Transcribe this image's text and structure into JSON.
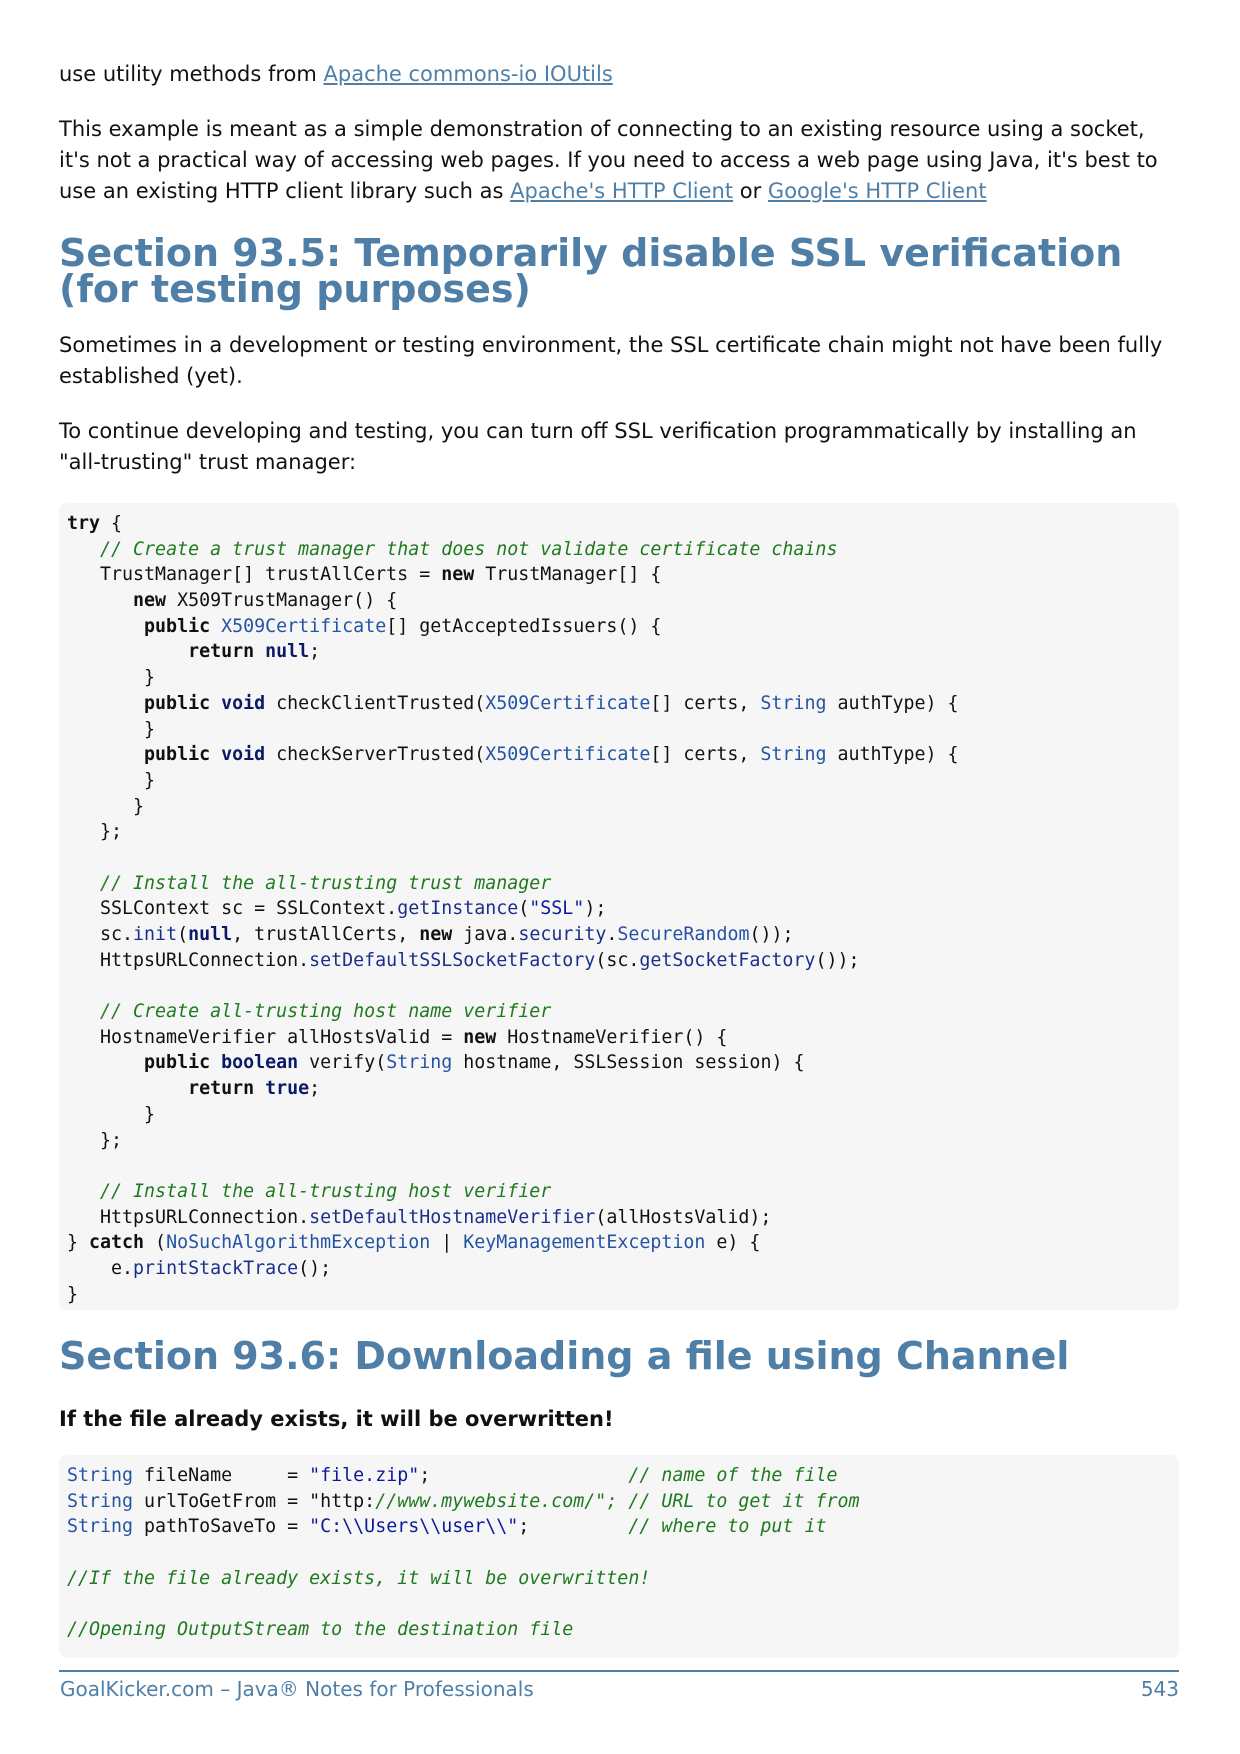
{
  "intro": {
    "line1_prefix": "use utility methods from ",
    "line1_link": "Apache commons-io IOUtils",
    "para2_text": "This example is meant as a simple demonstration of connecting to an existing resource using a socket, it's not a practical way of accessing web pages. If you need to access a web page using Java, it's best to use an existing HTTP client library such as ",
    "para2_link1": "Apache's HTTP Client",
    "para2_or": " or ",
    "para2_link2": "Google's HTTP Client"
  },
  "section1": {
    "title": "Section 93.5: Temporarily disable SSL verification (for testing purposes)",
    "para1": "Sometimes in a development or testing environment, the SSL certificate chain might not have been fully established (yet).",
    "para2": "To continue developing and testing, you can turn off SSL verification programmatically by installing an \"all-trusting\" trust manager:"
  },
  "code1": {
    "l1": "try {",
    "l2": "   // Create a trust manager that does not validate certificate chains",
    "l3": "   TrustManager[] trustAllCerts = new TrustManager[] {",
    "l4": "      new X509TrustManager() {",
    "l5": "       public X509Certificate[] getAcceptedIssuers() {",
    "l6": "           return null;",
    "l7": "       }",
    "l8": "       public void checkClientTrusted(X509Certificate[] certs, String authType) {",
    "l9": "       }",
    "l10": "       public void checkServerTrusted(X509Certificate[] certs, String authType) {",
    "l11": "       }",
    "l12": "      }",
    "l13": "   };",
    "l14": "",
    "l15": "   // Install the all-trusting trust manager",
    "l16": "   SSLContext sc = SSLContext.getInstance(\"SSL\");",
    "l17": "   sc.init(null, trustAllCerts, new java.security.SecureRandom());",
    "l18": "   HttpsURLConnection.setDefaultSSLSocketFactory(sc.getSocketFactory());",
    "l19": "",
    "l20": "   // Create all-trusting host name verifier",
    "l21": "   HostnameVerifier allHostsValid = new HostnameVerifier() {",
    "l22": "       public boolean verify(String hostname, SSLSession session) {",
    "l23": "           return true;",
    "l24": "       }",
    "l25": "   };",
    "l26": "",
    "l27": "   // Install the all-trusting host verifier",
    "l28": "   HttpsURLConnection.setDefaultHostnameVerifier(allHostsValid);",
    "l29": "} catch (NoSuchAlgorithmException | KeyManagementException e) {",
    "l30": "    e.printStackTrace();",
    "l31": "}"
  },
  "section2": {
    "title": "Section 93.6: Downloading a file using Channel",
    "warning": "If the file already exists, it will be overwritten!"
  },
  "code2": {
    "l1": "String fileName     = \"file.zip\";                  // name of the file",
    "l2": "String urlToGetFrom = \"http://www.mywebsite.com/\"; // URL to get it from",
    "l3": "String pathToSaveTo = \"C:\\\\Users\\\\user\\\\\";         // where to put it",
    "l4": "",
    "l5": "//If the file already exists, it will be overwritten!",
    "l6": "",
    "l7": "//Opening OutputStream to the destination file"
  },
  "footer": {
    "left": "GoalKicker.com – Java® Notes for Professionals",
    "right": "543"
  },
  "colors": {
    "accent": "#4f7fa6",
    "code_bg": "#f6f6f6",
    "comment": "#1f7a1f"
  }
}
